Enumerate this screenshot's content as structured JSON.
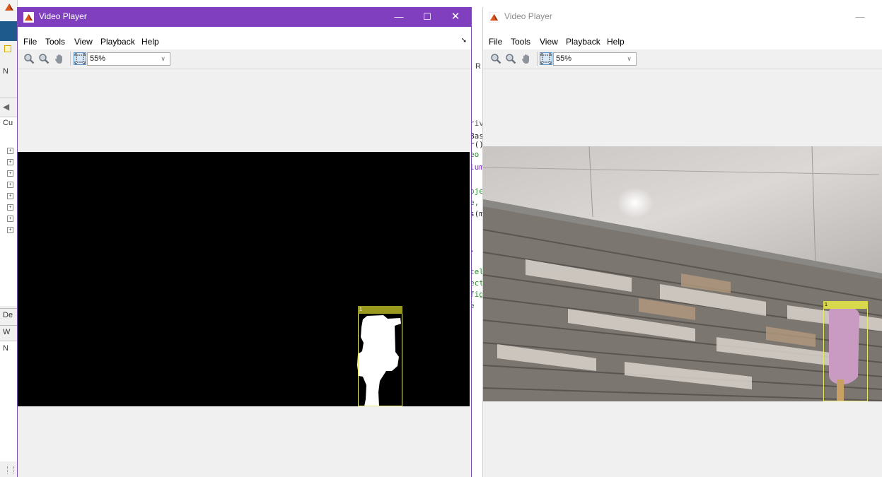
{
  "left_window": {
    "title": "Video Player",
    "menus": [
      "File",
      "Tools",
      "View",
      "Playback",
      "Help"
    ],
    "zoom_value": "55%",
    "tracker_label": "1"
  },
  "right_window": {
    "title": "Video Player",
    "menus": [
      "File",
      "Tools",
      "View",
      "Playback",
      "Help"
    ],
    "zoom_value": "55%",
    "tracker_label": "1"
  },
  "background_desktop": {
    "toolbar_letters": [
      "N",
      "R"
    ],
    "panel_labels": [
      "Cu",
      "De",
      "W",
      "N"
    ],
    "code_fragments": [
      "rivi",
      "Base",
      "r()",
      "eo",
      "lum",
      "oje",
      "e,",
      "s(m",
      ",",
      "tel",
      "ect",
      "fig",
      "e"
    ]
  },
  "colors": {
    "active_titlebar": "#7f3fbf",
    "bbox_outline": "#e8e86b",
    "bbox_label_bg_left": "#9a9a1e",
    "bbox_label_bg_right": "#d8d84c"
  }
}
